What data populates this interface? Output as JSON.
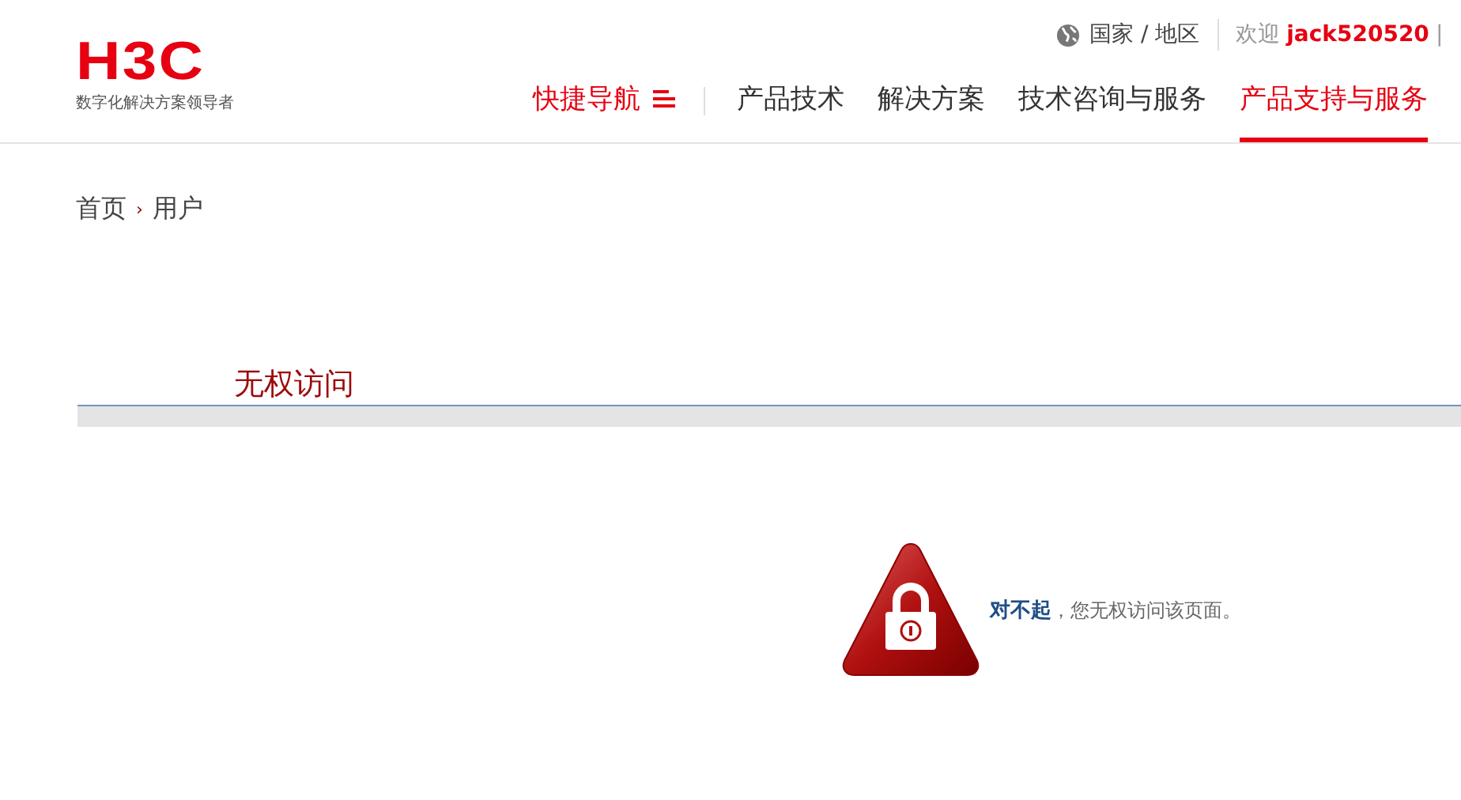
{
  "logo": {
    "brand": "H3C",
    "tagline": "数字化解决方案领导者"
  },
  "top_links": {
    "region": "国家 / 地区",
    "welcome": "欢迎",
    "username": "jack520520",
    "separator": "|"
  },
  "quick_nav": "快捷导航",
  "nav": [
    {
      "label": "产品技术",
      "selected": false
    },
    {
      "label": "解决方案",
      "selected": false
    },
    {
      "label": "技术咨询与服务",
      "selected": false
    },
    {
      "label": "产品支持与服务",
      "selected": true
    }
  ],
  "breadcrumb": [
    {
      "label": "首页"
    },
    {
      "label": "用户"
    }
  ],
  "breadcrumb_separator": "›",
  "section_title": "无权访问",
  "message": {
    "lead": "对不起",
    "rest": "，您无权访问该页面。"
  }
}
